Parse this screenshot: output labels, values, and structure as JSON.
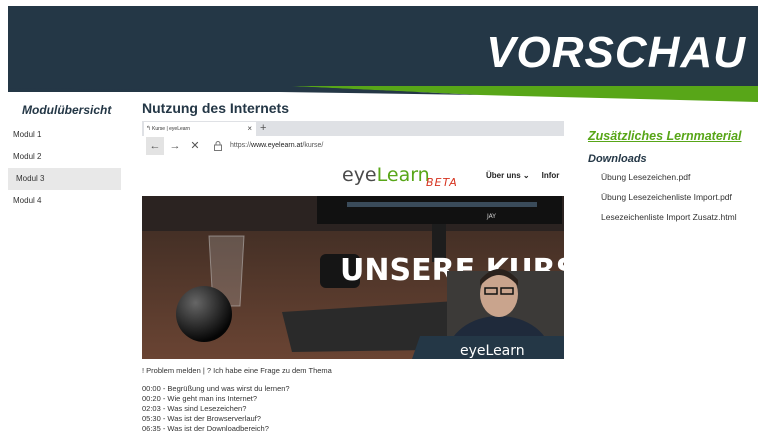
{
  "banner": {
    "title": "VORSCHAU"
  },
  "module_nav": {
    "title": "Modulübersicht",
    "items": [
      {
        "label": "Modul 1"
      },
      {
        "label": "Modul 2"
      },
      {
        "label": "Modul 3"
      },
      {
        "label": "Modul 4"
      }
    ],
    "active_index": 2
  },
  "main": {
    "title": "Nutzung des Internets"
  },
  "browser": {
    "tab_title": "Kurse | eyeLearn",
    "tab_close": "×",
    "new_tab": "+",
    "url_prefix": "https://",
    "url_domain": "www.eyelearn.at",
    "url_path": "/kurse/",
    "site_logo_eye": "eye",
    "site_logo_learn": "Learn",
    "site_logo_beta": "BETA",
    "site_nav": [
      "Über uns ⌄",
      "Infor"
    ],
    "hero_text": "UNSERE KURS",
    "monitor_label": "JAY",
    "watermark_eye": "eye",
    "watermark_learn": "Learn"
  },
  "video_footer": {
    "report_line": "! Problem melden | ? Ich habe eine Frage zu dem Thema"
  },
  "chapters": [
    "00:00 - Begrüßung und was wirst du lernen?",
    "00:20 - Wie geht man ins Internet?",
    "02:03 - Was sind Lesezeichen?",
    "05:30 - Was ist der Browserverlauf?",
    "06:35 - Was ist der Downloadbereich?"
  ],
  "extra": {
    "title": "Zusätzliches Lernmaterial",
    "downloads_title": "Downloads",
    "files": [
      "Übung Lesezeichen.pdf",
      "Übung Lesezeichenliste Import.pdf",
      "Lesezeichenliste Import Zusatz.html"
    ]
  },
  "colors": {
    "navy": "#243746",
    "green": "#58a618",
    "beta_red": "#d6331f"
  }
}
